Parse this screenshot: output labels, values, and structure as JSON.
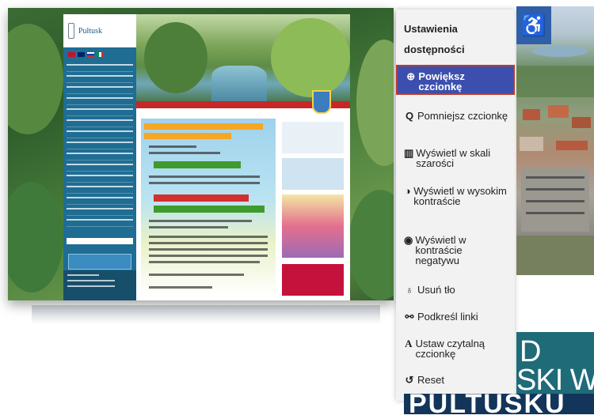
{
  "old_site": {
    "logo_text": "Pułtusk"
  },
  "accessibility_panel": {
    "title": "Ustawienia dostępności",
    "items": [
      {
        "icon": "zoom-in-icon",
        "glyph": "⊕",
        "label": "Powiększ czcionkę",
        "active": true
      },
      {
        "icon": "zoom-out-icon",
        "glyph": "Q",
        "label": "Pomniejsz czcionkę",
        "active": false
      },
      {
        "icon": "grayscale-icon",
        "glyph": "▥",
        "label": "Wyświetl w skali szarości",
        "active": false
      },
      {
        "icon": "contrast-icon",
        "glyph": "◑",
        "label": "Wyświetl w wysokim kontraście",
        "active": false
      },
      {
        "icon": "eye-icon",
        "glyph": "◉",
        "label": "Wyświetl w kontraście negatywu",
        "active": false
      },
      {
        "icon": "bulb-icon",
        "glyph": "♁",
        "label": "Usuń tło",
        "active": false
      },
      {
        "icon": "link-icon",
        "glyph": "⚯",
        "label": "Podkreśl linki",
        "active": false
      },
      {
        "icon": "font-icon",
        "glyph": "A",
        "label": "Ustaw czytalną czcionkę",
        "active": false
      },
      {
        "icon": "reset-icon",
        "glyph": "↺",
        "label": "Reset",
        "active": false
      }
    ]
  },
  "accessibility_toggle": {
    "icon": "wheelchair-icon",
    "glyph": "♿"
  },
  "logo_fragment": {
    "line1": "D",
    "line2": "SKI W",
    "line3": "PULTUSKU"
  },
  "colors": {
    "panel_bg": "#f2f2f2",
    "active_item_bg": "#3d4fae",
    "toggle_bg": "#2f5fa8",
    "site_blue": "#1f6d93",
    "site_red": "#c62828"
  }
}
